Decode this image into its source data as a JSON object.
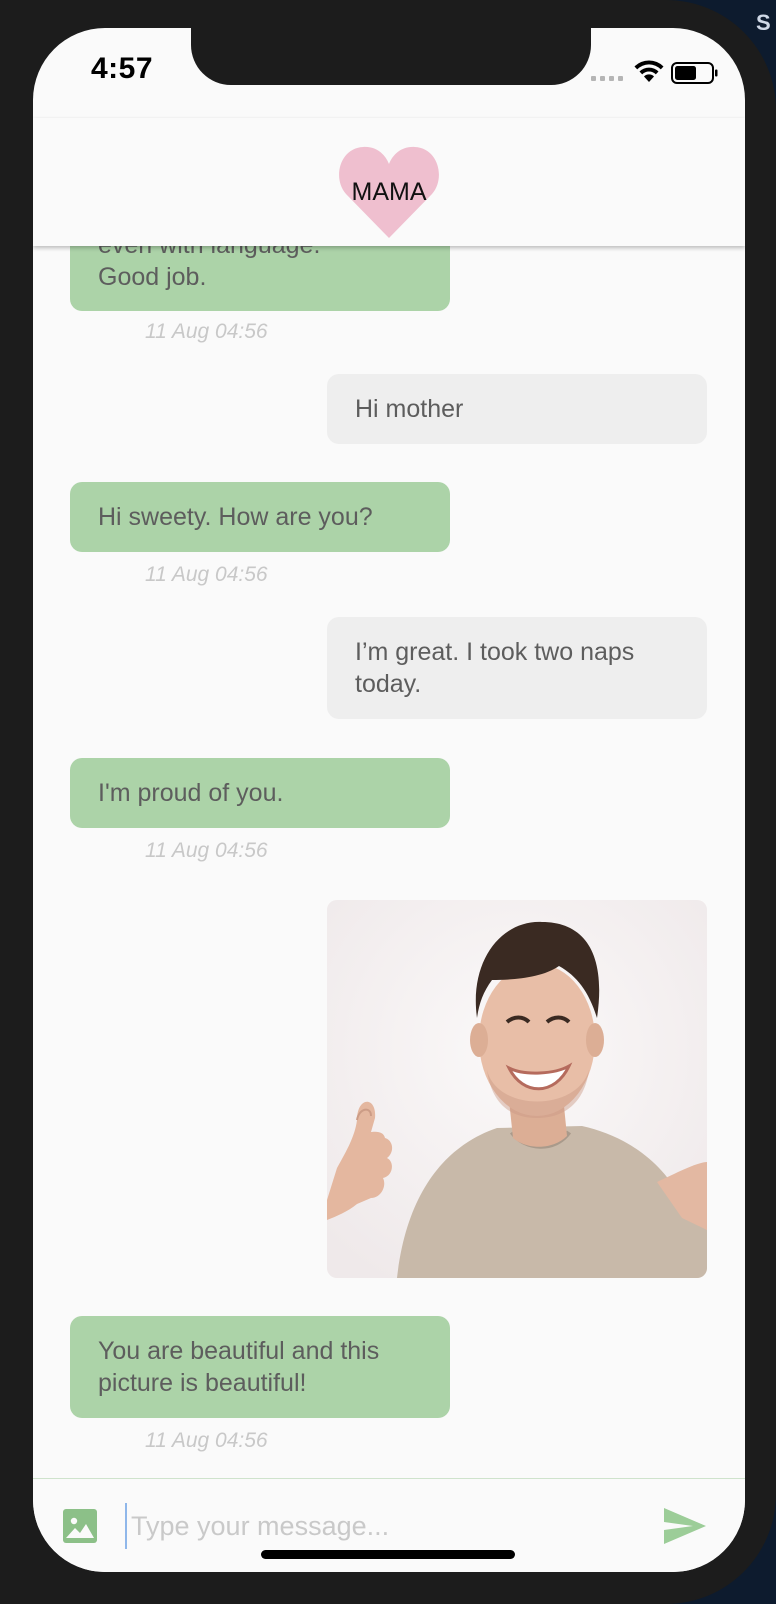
{
  "status_bar": {
    "time": "4:57"
  },
  "desktop_edge_letter": "S",
  "header": {
    "title": "MAMA",
    "heart_color": "#efbfcf"
  },
  "messages": [
    {
      "id": "m1",
      "sender": "mama",
      "text_line1": "even with language.",
      "text_line2": "Good job.",
      "timestamp": "11 Aug 04:56"
    },
    {
      "id": "m2",
      "sender": "me",
      "text": "Hi mother"
    },
    {
      "id": "m3",
      "sender": "mama",
      "text": "Hi sweety. How are you?",
      "timestamp": "11 Aug 04:56"
    },
    {
      "id": "m4",
      "sender": "me",
      "text_line1": "I’m great. I took two naps",
      "text_line2": "today."
    },
    {
      "id": "m5",
      "sender": "mama",
      "text": "I'm proud of you.",
      "timestamp": "11 Aug 04:56"
    },
    {
      "id": "m6",
      "sender": "me",
      "type": "image",
      "image_description": "photo-of-smiling-man-thumbs-up"
    },
    {
      "id": "m7",
      "sender": "mama",
      "text_line1": "You are beautiful and this",
      "text_line2": "picture is beautiful!",
      "timestamp": "11 Aug 04:56"
    }
  ],
  "composer": {
    "placeholder": "Type your message...",
    "value": ""
  },
  "colors": {
    "incoming_bubble": "#acd3a8",
    "outgoing_bubble": "#eeeeee",
    "send_icon": "#9ccd98",
    "gallery_icon": "#8cc088"
  },
  "icons": {
    "gallery": "image-icon",
    "send": "send-icon",
    "wifi": "wifi-icon",
    "battery": "battery-icon"
  }
}
